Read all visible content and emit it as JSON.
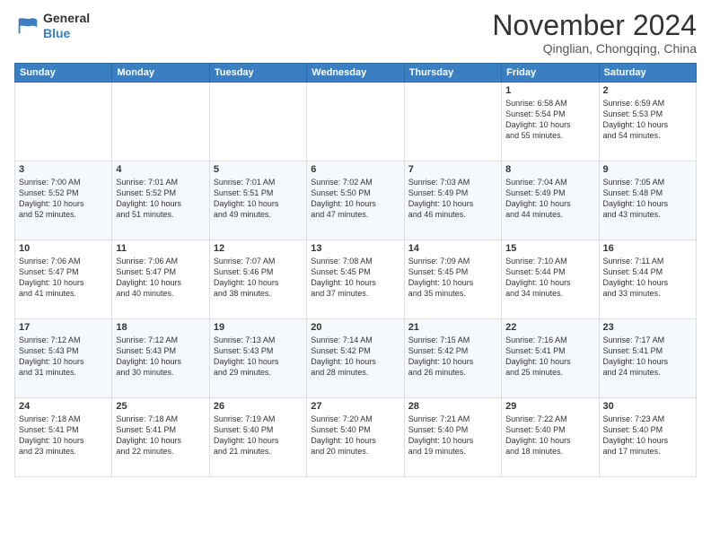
{
  "header": {
    "logo": {
      "line1": "General",
      "line2": "Blue"
    },
    "title": "November 2024",
    "location": "Qinglian, Chongqing, China"
  },
  "weekdays": [
    "Sunday",
    "Monday",
    "Tuesday",
    "Wednesday",
    "Thursday",
    "Friday",
    "Saturday"
  ],
  "weeks": [
    [
      {
        "day": "",
        "info": ""
      },
      {
        "day": "",
        "info": ""
      },
      {
        "day": "",
        "info": ""
      },
      {
        "day": "",
        "info": ""
      },
      {
        "day": "",
        "info": ""
      },
      {
        "day": "1",
        "info": "Sunrise: 6:58 AM\nSunset: 5:54 PM\nDaylight: 10 hours\nand 55 minutes."
      },
      {
        "day": "2",
        "info": "Sunrise: 6:59 AM\nSunset: 5:53 PM\nDaylight: 10 hours\nand 54 minutes."
      }
    ],
    [
      {
        "day": "3",
        "info": "Sunrise: 7:00 AM\nSunset: 5:52 PM\nDaylight: 10 hours\nand 52 minutes."
      },
      {
        "day": "4",
        "info": "Sunrise: 7:01 AM\nSunset: 5:52 PM\nDaylight: 10 hours\nand 51 minutes."
      },
      {
        "day": "5",
        "info": "Sunrise: 7:01 AM\nSunset: 5:51 PM\nDaylight: 10 hours\nand 49 minutes."
      },
      {
        "day": "6",
        "info": "Sunrise: 7:02 AM\nSunset: 5:50 PM\nDaylight: 10 hours\nand 47 minutes."
      },
      {
        "day": "7",
        "info": "Sunrise: 7:03 AM\nSunset: 5:49 PM\nDaylight: 10 hours\nand 46 minutes."
      },
      {
        "day": "8",
        "info": "Sunrise: 7:04 AM\nSunset: 5:49 PM\nDaylight: 10 hours\nand 44 minutes."
      },
      {
        "day": "9",
        "info": "Sunrise: 7:05 AM\nSunset: 5:48 PM\nDaylight: 10 hours\nand 43 minutes."
      }
    ],
    [
      {
        "day": "10",
        "info": "Sunrise: 7:06 AM\nSunset: 5:47 PM\nDaylight: 10 hours\nand 41 minutes."
      },
      {
        "day": "11",
        "info": "Sunrise: 7:06 AM\nSunset: 5:47 PM\nDaylight: 10 hours\nand 40 minutes."
      },
      {
        "day": "12",
        "info": "Sunrise: 7:07 AM\nSunset: 5:46 PM\nDaylight: 10 hours\nand 38 minutes."
      },
      {
        "day": "13",
        "info": "Sunrise: 7:08 AM\nSunset: 5:45 PM\nDaylight: 10 hours\nand 37 minutes."
      },
      {
        "day": "14",
        "info": "Sunrise: 7:09 AM\nSunset: 5:45 PM\nDaylight: 10 hours\nand 35 minutes."
      },
      {
        "day": "15",
        "info": "Sunrise: 7:10 AM\nSunset: 5:44 PM\nDaylight: 10 hours\nand 34 minutes."
      },
      {
        "day": "16",
        "info": "Sunrise: 7:11 AM\nSunset: 5:44 PM\nDaylight: 10 hours\nand 33 minutes."
      }
    ],
    [
      {
        "day": "17",
        "info": "Sunrise: 7:12 AM\nSunset: 5:43 PM\nDaylight: 10 hours\nand 31 minutes."
      },
      {
        "day": "18",
        "info": "Sunrise: 7:12 AM\nSunset: 5:43 PM\nDaylight: 10 hours\nand 30 minutes."
      },
      {
        "day": "19",
        "info": "Sunrise: 7:13 AM\nSunset: 5:43 PM\nDaylight: 10 hours\nand 29 minutes."
      },
      {
        "day": "20",
        "info": "Sunrise: 7:14 AM\nSunset: 5:42 PM\nDaylight: 10 hours\nand 28 minutes."
      },
      {
        "day": "21",
        "info": "Sunrise: 7:15 AM\nSunset: 5:42 PM\nDaylight: 10 hours\nand 26 minutes."
      },
      {
        "day": "22",
        "info": "Sunrise: 7:16 AM\nSunset: 5:41 PM\nDaylight: 10 hours\nand 25 minutes."
      },
      {
        "day": "23",
        "info": "Sunrise: 7:17 AM\nSunset: 5:41 PM\nDaylight: 10 hours\nand 24 minutes."
      }
    ],
    [
      {
        "day": "24",
        "info": "Sunrise: 7:18 AM\nSunset: 5:41 PM\nDaylight: 10 hours\nand 23 minutes."
      },
      {
        "day": "25",
        "info": "Sunrise: 7:18 AM\nSunset: 5:41 PM\nDaylight: 10 hours\nand 22 minutes."
      },
      {
        "day": "26",
        "info": "Sunrise: 7:19 AM\nSunset: 5:40 PM\nDaylight: 10 hours\nand 21 minutes."
      },
      {
        "day": "27",
        "info": "Sunrise: 7:20 AM\nSunset: 5:40 PM\nDaylight: 10 hours\nand 20 minutes."
      },
      {
        "day": "28",
        "info": "Sunrise: 7:21 AM\nSunset: 5:40 PM\nDaylight: 10 hours\nand 19 minutes."
      },
      {
        "day": "29",
        "info": "Sunrise: 7:22 AM\nSunset: 5:40 PM\nDaylight: 10 hours\nand 18 minutes."
      },
      {
        "day": "30",
        "info": "Sunrise: 7:23 AM\nSunset: 5:40 PM\nDaylight: 10 hours\nand 17 minutes."
      }
    ]
  ]
}
